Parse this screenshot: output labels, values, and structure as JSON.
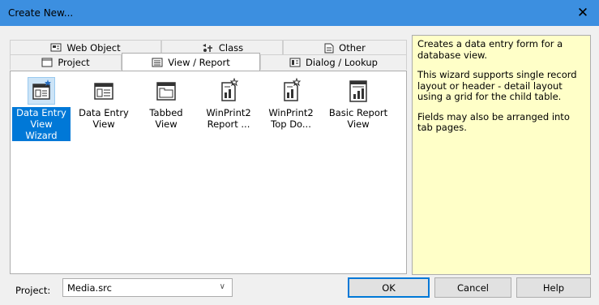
{
  "window": {
    "title": "Create New...",
    "close_glyph": "✕"
  },
  "tabs": {
    "row_back": [
      {
        "label": "Web Object",
        "icon": "web-object-icon"
      },
      {
        "label": "Class",
        "icon": "class-icon"
      },
      {
        "label": "Other",
        "icon": "other-icon"
      }
    ],
    "row_front": [
      {
        "label": "Project",
        "icon": "project-icon"
      },
      {
        "label": "View / Report",
        "icon": "view-report-icon",
        "active": true
      },
      {
        "label": "Dialog / Lookup",
        "icon": "dialog-lookup-icon"
      }
    ]
  },
  "items": [
    {
      "label_line1": "Data Entry",
      "label_line2": "View Wizard",
      "icon": "data-entry-wizard-icon",
      "selected": true
    },
    {
      "label_line1": "Data Entry",
      "label_line2": "View",
      "icon": "data-entry-view-icon"
    },
    {
      "label_line1": "Tabbed View",
      "label_line2": "",
      "icon": "tabbed-view-icon"
    },
    {
      "label_line1": "WinPrint2",
      "label_line2": "Report ...",
      "icon": "winprint-report-icon"
    },
    {
      "label_line1": "WinPrint2",
      "label_line2": "Top Do...",
      "icon": "winprint-top-icon"
    },
    {
      "label_line1": "Basic Report",
      "label_line2": "View",
      "icon": "basic-report-icon"
    }
  ],
  "description": {
    "p1": "Creates a data entry form for a database view.",
    "p2": "This wizard supports single record layout or header - detail layout using a grid for the child table.",
    "p3": "Fields may also be arranged into tab pages."
  },
  "footer": {
    "project_label": "Project:",
    "project_value": "Media.src",
    "ok_label": "OK",
    "cancel_label": "Cancel",
    "help_label": "Help"
  },
  "colors": {
    "titlebar": "#3c8fe0",
    "selection": "#0078d7",
    "description_bg": "#ffffc8"
  }
}
